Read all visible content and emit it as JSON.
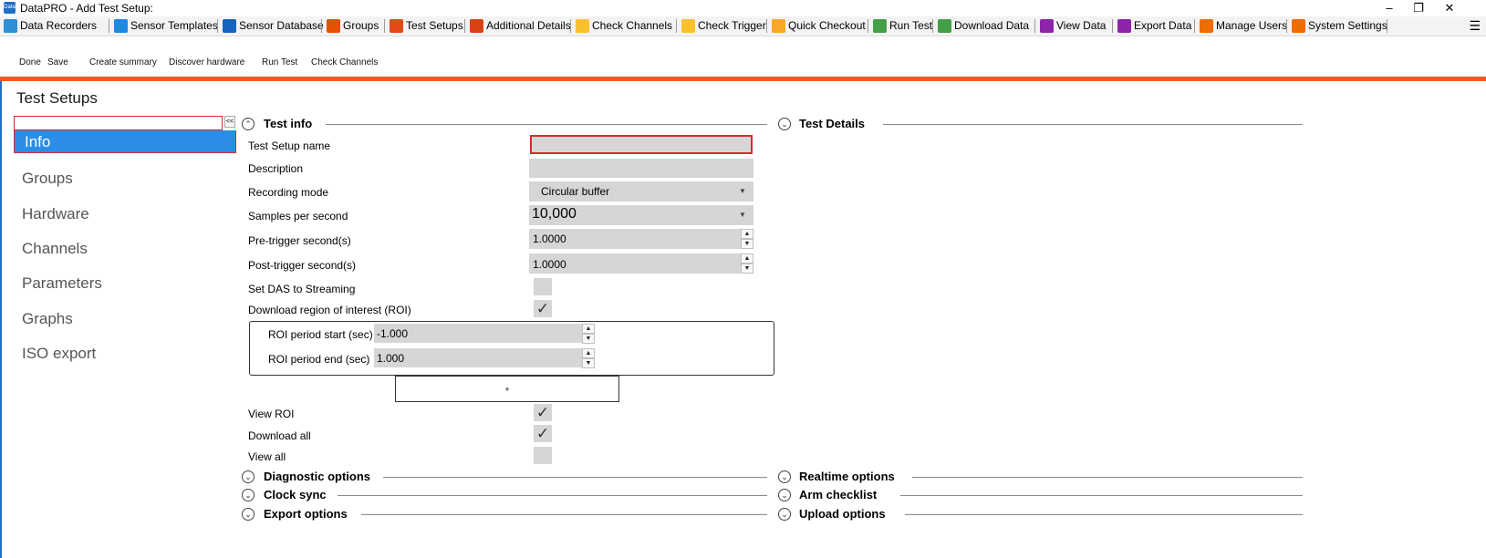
{
  "window": {
    "app_icon_text": "Data PRO",
    "title": "DataPRO - Add Test Setup:",
    "minimize_glyph": "–",
    "restore_glyph": "❐",
    "close_glyph": "✕"
  },
  "tabs": [
    {
      "label": "Data Recorders",
      "icon": "data-recorders-icon",
      "color": "#2d8fd5"
    },
    {
      "label": "Sensor Templates",
      "icon": "sensor-templates-icon",
      "color": "#1e88e5"
    },
    {
      "label": "Sensor Database",
      "icon": "sensor-database-icon",
      "color": "#1565c0"
    },
    {
      "label": "Groups",
      "icon": "groups-icon",
      "color": "#e65100"
    },
    {
      "label": "Test Setups",
      "icon": "test-setups-icon",
      "color": "#e64a19"
    },
    {
      "label": "Additional Details",
      "icon": "additional-details-icon",
      "color": "#d84315"
    },
    {
      "label": "Check Channels",
      "icon": "check-channels-icon",
      "color": "#fbc02d"
    },
    {
      "label": "Check Trigger",
      "icon": "check-trigger-icon",
      "color": "#fbc02d"
    },
    {
      "label": "Quick Checkout",
      "icon": "quick-checkout-icon",
      "color": "#f9a825"
    },
    {
      "label": "Run Test",
      "icon": "run-test-icon",
      "color": "#43a047"
    },
    {
      "label": "Download Data",
      "icon": "download-data-icon",
      "color": "#43a047"
    },
    {
      "label": "View Data",
      "icon": "view-data-icon",
      "color": "#8e24aa"
    },
    {
      "label": "Export Data",
      "icon": "export-data-icon",
      "color": "#8e24aa"
    },
    {
      "label": "Manage Users",
      "icon": "manage-users-icon",
      "color": "#ef6c00"
    },
    {
      "label": "System Settings",
      "icon": "system-settings-icon",
      "color": "#ef6c00"
    }
  ],
  "menu_glyph": "☰",
  "commands": [
    "Done",
    "Save",
    "Create summary",
    "Discover hardware",
    "Run Test",
    "Check Channels"
  ],
  "accent_color": "#f15a22",
  "page_title": "Test Setups",
  "sidebar": {
    "search_value": "",
    "collapse_label": "<<",
    "items": [
      "Info",
      "Groups",
      "Hardware",
      "Channels",
      "Parameters",
      "Graphs",
      "ISO export"
    ],
    "active_index": 0
  },
  "sections": {
    "test_info": "Test info",
    "test_details": "Test Details",
    "diagnostic_options": "Diagnostic options",
    "realtime_options": "Realtime options",
    "clock_sync": "Clock sync",
    "arm_checklist": "Arm checklist",
    "export_options": "Export options",
    "upload_options": "Upload options"
  },
  "form": {
    "test_setup_name": {
      "label": "Test Setup name",
      "value": ""
    },
    "description": {
      "label": "Description",
      "value": ""
    },
    "recording_mode": {
      "label": "Recording mode",
      "value": "Circular buffer"
    },
    "samples_per_second": {
      "label": "Samples per second",
      "value": "10,000"
    },
    "pre_trigger": {
      "label": "Pre-trigger second(s)",
      "value": "1.0000"
    },
    "post_trigger": {
      "label": "Post-trigger second(s)",
      "value": "1.0000"
    },
    "set_das_streaming": {
      "label": "Set DAS to Streaming",
      "checked": false
    },
    "download_roi": {
      "label": "Download region of interest (ROI)",
      "checked": true
    },
    "roi_start": {
      "label": "ROI period start (sec)",
      "value": "-1.000"
    },
    "roi_end": {
      "label": "ROI period end (sec)",
      "value": "1.000"
    },
    "add_roi_label": "+",
    "view_roi": {
      "label": "View ROI",
      "checked": true
    },
    "download_all": {
      "label": "Download all",
      "checked": true
    },
    "view_all": {
      "label": "View all",
      "checked": false
    }
  },
  "check_glyph": "✓",
  "chevron_up": "⌃",
  "chevron_down": "⌄",
  "dropdown_glyph": "▼",
  "spin_up": "▲",
  "spin_down": "▼"
}
